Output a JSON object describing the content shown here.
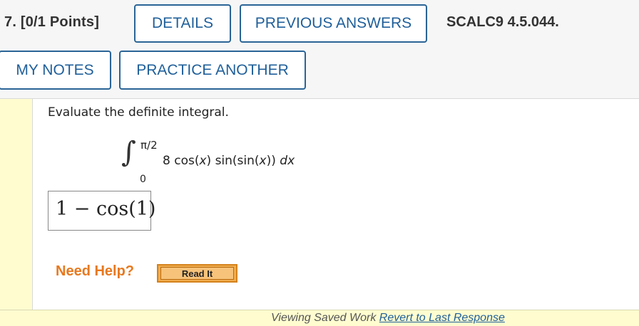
{
  "question": {
    "number_label": "7.",
    "points_label": "[0/1 Points]",
    "code": "SCALC9 4.5.044."
  },
  "buttons": {
    "details": "DETAILS",
    "previous_answers": "PREVIOUS ANSWERS",
    "my_notes": "MY NOTES",
    "practice_another": "PRACTICE ANOTHER",
    "read_it": "Read It"
  },
  "problem": {
    "prompt": "Evaluate the definite integral.",
    "upper_limit": "π/2",
    "lower_limit": "0",
    "integrand": {
      "coef": "8 cos(",
      "var1": "x",
      "mid": ") sin(sin(",
      "var2": "x",
      "end": ")) ",
      "differential": "dx"
    }
  },
  "answer": {
    "value": "1 − cos(1)"
  },
  "help": {
    "label": "Need Help?"
  },
  "footer": {
    "text": "Viewing Saved Work ",
    "link": "Revert to Last Response"
  },
  "colors": {
    "button_border": "#2a6496",
    "button_text": "#1f5f9a",
    "need_help": "#e8781e",
    "strip": "#fffdd0"
  }
}
